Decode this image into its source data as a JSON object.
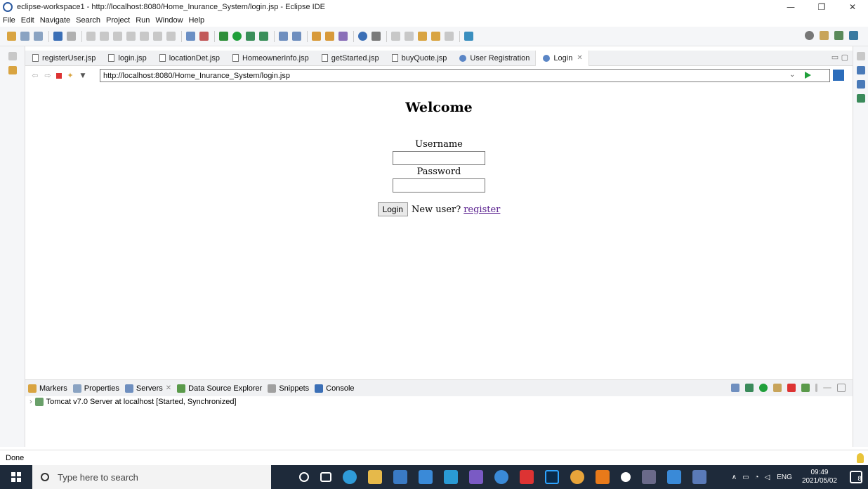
{
  "window": {
    "title": "eclipse-workspace1 - http://localhost:8080/Home_Inurance_System/login.jsp - Eclipse IDE",
    "minimize": "—",
    "maximize": "❐",
    "close": "✕"
  },
  "menu": [
    "File",
    "Edit",
    "Navigate",
    "Search",
    "Project",
    "Run",
    "Window",
    "Help"
  ],
  "tabs": [
    {
      "label": "registerUser.jsp"
    },
    {
      "label": "login.jsp"
    },
    {
      "label": "locationDet.jsp"
    },
    {
      "label": "HomeownerInfo.jsp"
    },
    {
      "label": "getStarted.jsp"
    },
    {
      "label": "buyQuote.jsp"
    },
    {
      "label": "User Registration"
    },
    {
      "label": "Login"
    }
  ],
  "browser": {
    "url": "http://localhost:8080/Home_Inurance_System/login.jsp"
  },
  "page": {
    "heading": "Welcome",
    "username_label": "Username",
    "password_label": "Password",
    "login_button": "Login",
    "new_user_text": "New user?",
    "register_link": "register"
  },
  "bottom_tabs": [
    "Markers",
    "Properties",
    "Servers",
    "Data Source Explorer",
    "Snippets",
    "Console"
  ],
  "server_entry": "Tomcat v7.0 Server at localhost  [Started, Synchronized]",
  "status": "Done",
  "taskbar": {
    "search_placeholder": "Type here to search",
    "lang": "ENG",
    "time": "09:49",
    "date": "2021/05/02",
    "notifications": "8"
  },
  "colors": {
    "taskbar_bg": "#1e2a3a",
    "link_visited": "#551a8b",
    "accent_blue": "#2c6dbb"
  }
}
